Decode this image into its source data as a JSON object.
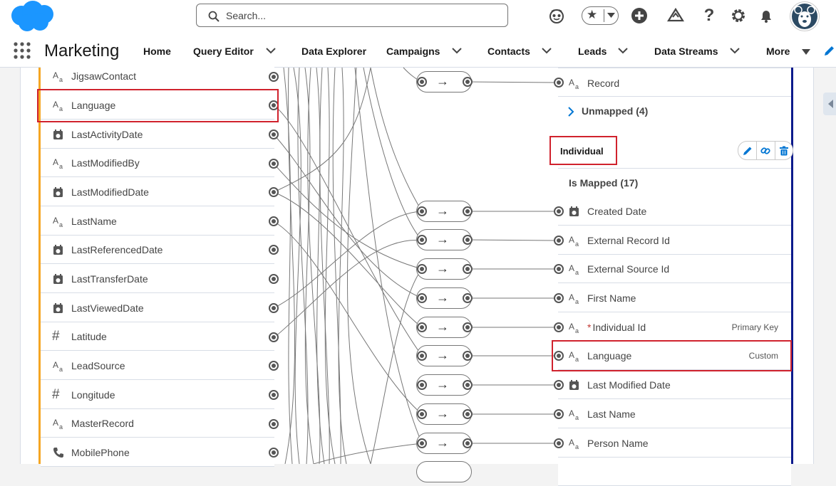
{
  "header": {
    "search_placeholder": "Search...",
    "app_name": "Marketing",
    "nav": [
      {
        "label": "Home"
      },
      {
        "label": "Query Editor"
      },
      {
        "label": "Data Explorer"
      },
      {
        "label": "Campaigns"
      },
      {
        "label": "Contacts"
      },
      {
        "label": "Leads"
      },
      {
        "label": "Data Streams"
      },
      {
        "label": "More"
      }
    ]
  },
  "left_fields": [
    {
      "label": "JigsawContact",
      "icon": "text-type-icon"
    },
    {
      "label": "Language",
      "icon": "text-type-icon"
    },
    {
      "label": "LastActivityDate",
      "icon": "date-type-icon"
    },
    {
      "label": "LastModifiedBy",
      "icon": "text-type-icon"
    },
    {
      "label": "LastModifiedDate",
      "icon": "date-type-icon"
    },
    {
      "label": "LastName",
      "icon": "text-type-icon"
    },
    {
      "label": "LastReferencedDate",
      "icon": "date-type-icon"
    },
    {
      "label": "LastTransferDate",
      "icon": "date-type-icon"
    },
    {
      "label": "LastViewedDate",
      "icon": "date-type-icon"
    },
    {
      "label": "Latitude",
      "icon": "number-type-icon"
    },
    {
      "label": "LeadSource",
      "icon": "text-type-icon"
    },
    {
      "label": "Longitude",
      "icon": "number-type-icon"
    },
    {
      "label": "MasterRecord",
      "icon": "text-type-icon"
    },
    {
      "label": "MobilePhone",
      "icon": "phone-type-icon"
    }
  ],
  "right_top": {
    "record_label": "Record",
    "unmapped_label": "Unmapped (4)"
  },
  "individual": {
    "name": "Individual",
    "mapped_label": "Is Mapped (17)",
    "fields": [
      {
        "label": "Created Date",
        "icon": "date-type-icon",
        "meta": "",
        "required": ""
      },
      {
        "label": "External Record Id",
        "icon": "text-type-icon",
        "meta": "",
        "required": ""
      },
      {
        "label": "External Source Id",
        "icon": "text-type-icon",
        "meta": "",
        "required": ""
      },
      {
        "label": "First Name",
        "icon": "text-type-icon",
        "meta": "",
        "required": ""
      },
      {
        "label": "Individual Id",
        "icon": "text-type-icon",
        "meta": "Primary Key",
        "required": "*"
      },
      {
        "label": "Language",
        "icon": "text-type-icon",
        "meta": "Custom",
        "required": ""
      },
      {
        "label": "Last Modified Date",
        "icon": "date-type-icon",
        "meta": "",
        "required": ""
      },
      {
        "label": "Last Name",
        "icon": "text-type-icon",
        "meta": "",
        "required": ""
      },
      {
        "label": "Person Name",
        "icon": "text-type-icon",
        "meta": "",
        "required": ""
      }
    ]
  },
  "icon_glyphs": {
    "text_a": "A",
    "text_small": "a",
    "number": "#",
    "arrow": "→",
    "star": "★",
    "question": "?"
  },
  "colors": {
    "brand": "#1b96ff",
    "left_accent": "#f5a623",
    "right_accent": "#0b1a8c",
    "highlight": "#d0222d"
  }
}
